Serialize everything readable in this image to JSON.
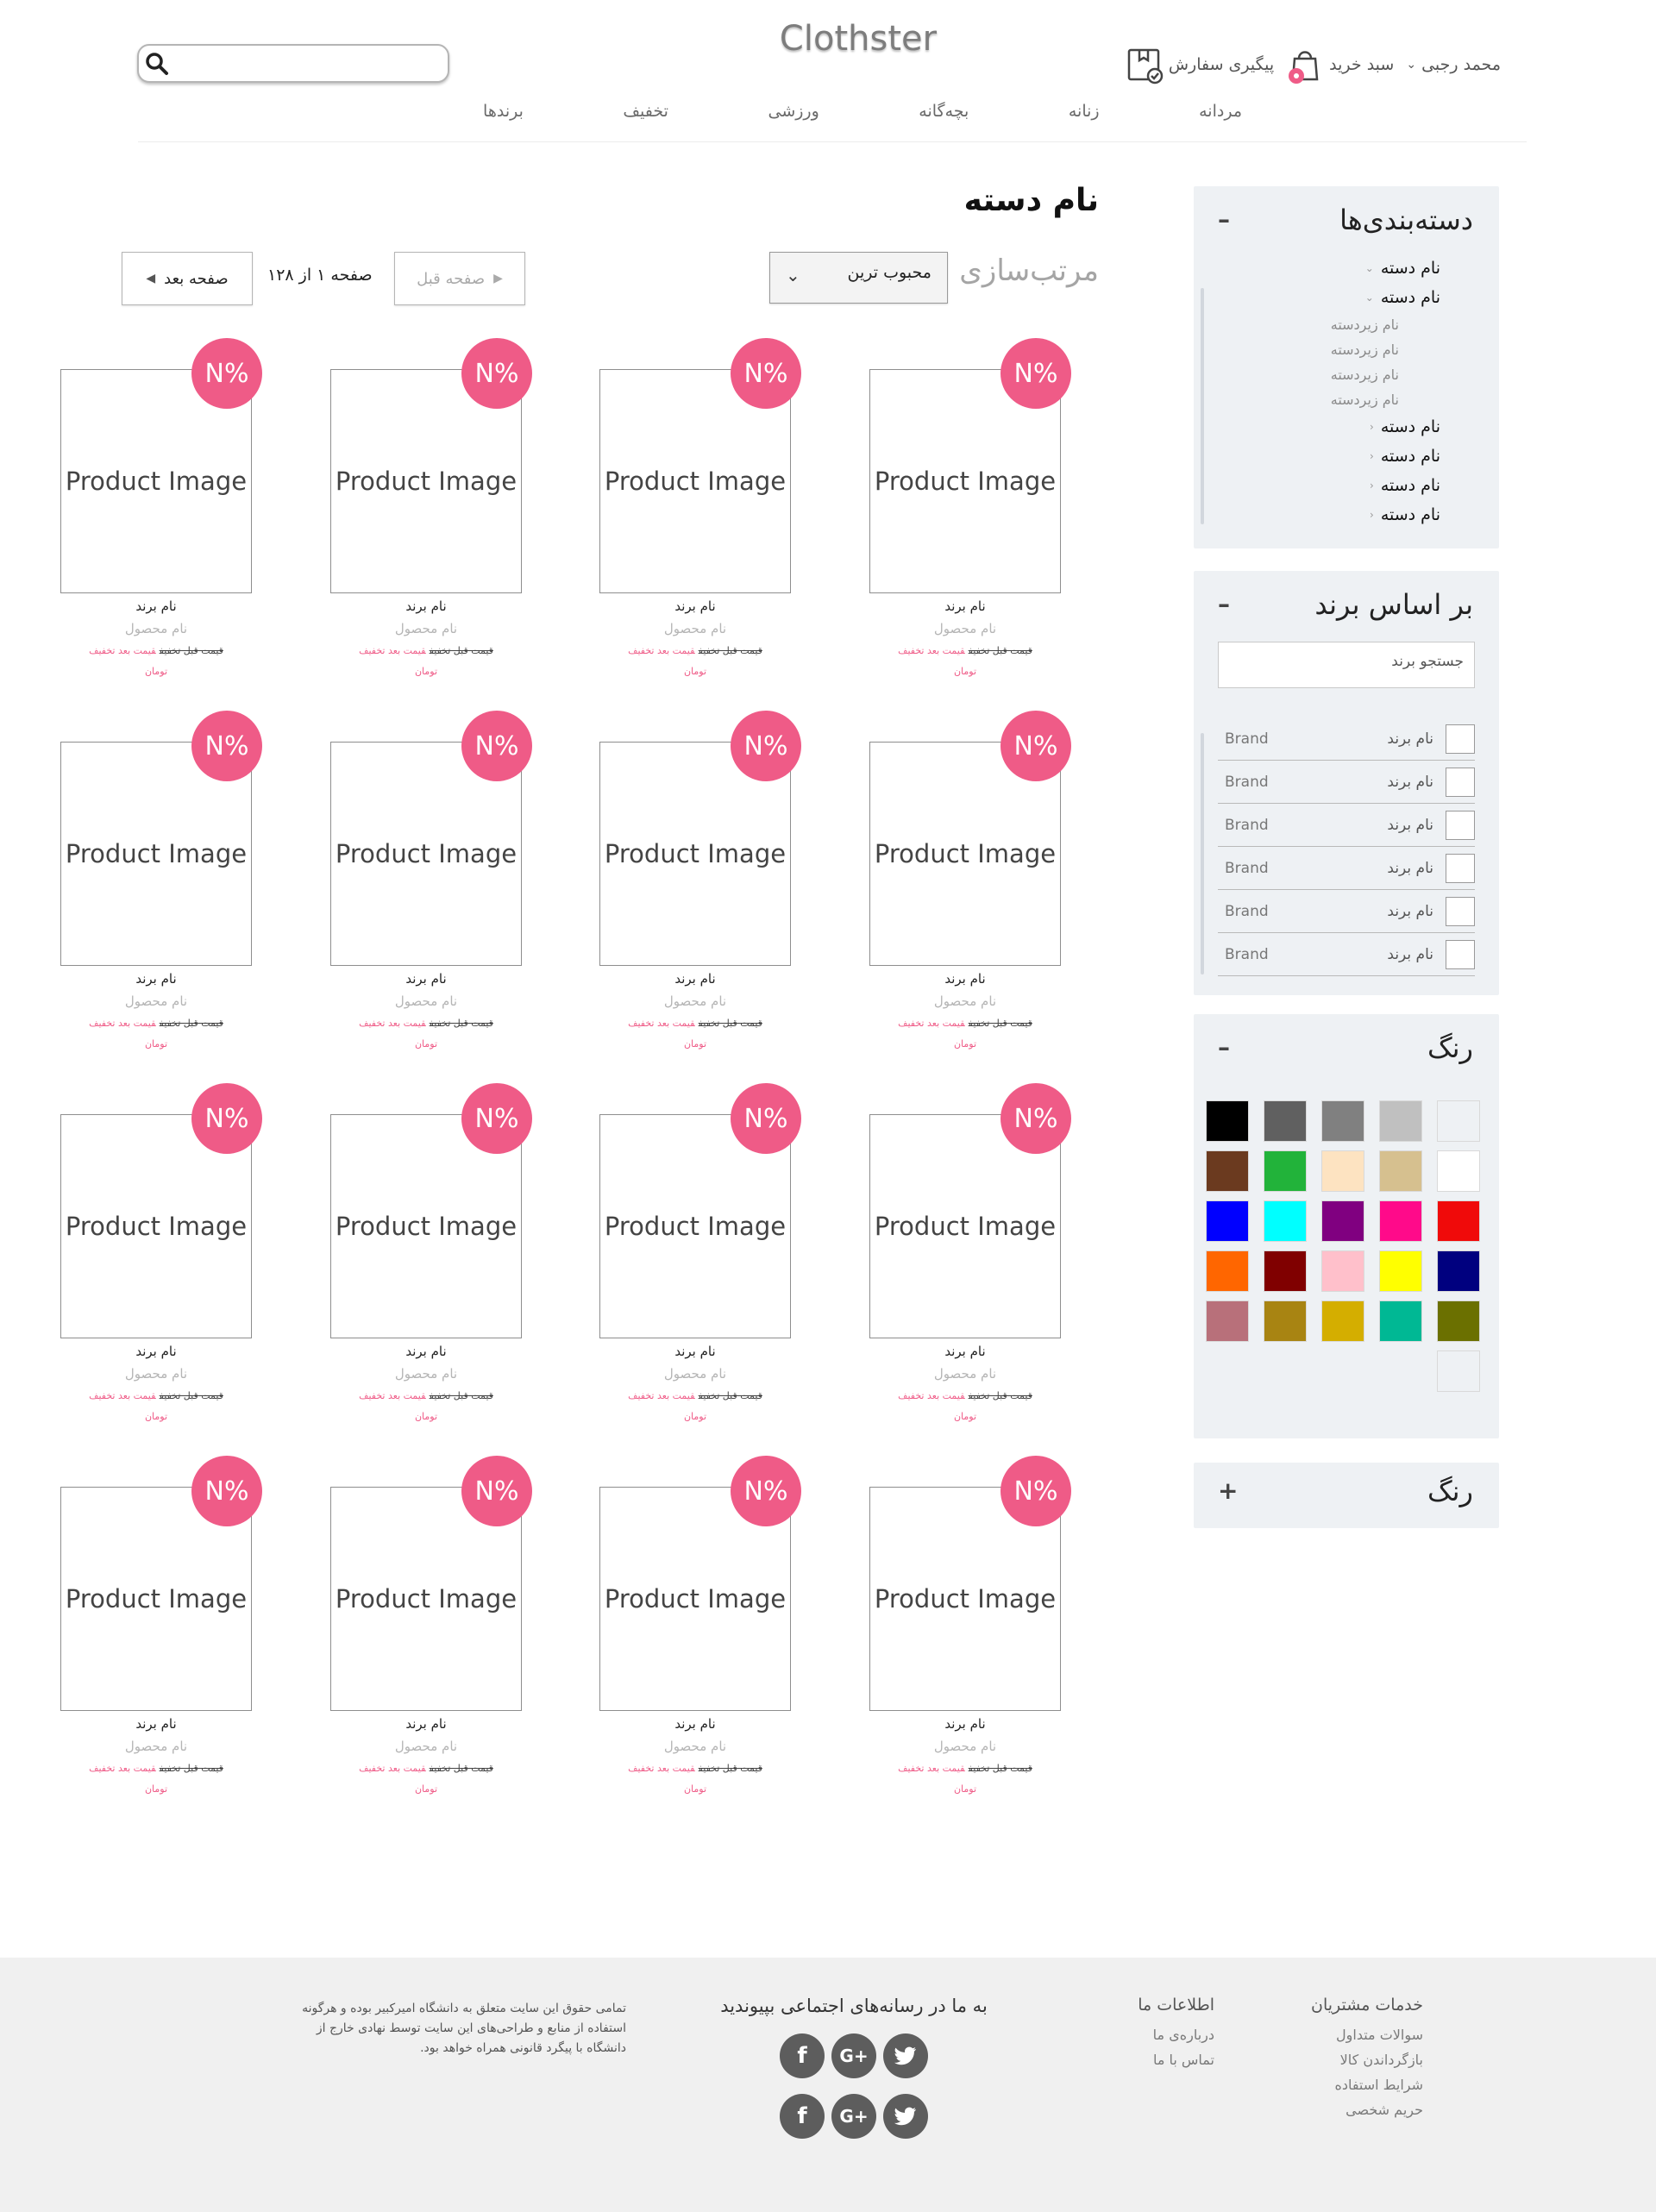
{
  "header": {
    "logo": "Clothster",
    "search_placeholder": "",
    "user_name": "محمد رجبی",
    "cart_label": "سبد خرید",
    "order_tracking_label": "پیگیری سفارش",
    "accent_color": "#ef5b87"
  },
  "nav": {
    "items": [
      "مردانه",
      "زنانه",
      "بچه‌گانه",
      "ورزشی",
      "تخفیف",
      "برندها"
    ]
  },
  "main": {
    "category_title": "نام دسته",
    "sort_label": "مرتب‌سازی",
    "sort_selected": "محبوب ترین",
    "pagination": {
      "prev_label": "صفحه قبل",
      "next_label": "صفحه بعد",
      "info": "صفحه ۱ از ۱۲۸"
    },
    "product": {
      "image_text": "Product Image",
      "badge": "N%",
      "brand": "نام برند",
      "name": "نام محصول",
      "old_price": "قیمت قبل تخفیف",
      "new_price": "قیمت بعد تخفیف",
      "currency": "تومان"
    }
  },
  "sidebar": {
    "categories": {
      "title": "دسته‌بندی‌ها",
      "toggle": "–",
      "items": [
        {
          "label": "نام دسته",
          "type": "cat"
        },
        {
          "label": "نام دسته",
          "type": "cat"
        },
        {
          "label": "نام زیردسته",
          "type": "sub"
        },
        {
          "label": "نام زیردسته",
          "type": "sub"
        },
        {
          "label": "نام زیردسته",
          "type": "sub"
        },
        {
          "label": "نام زیردسته",
          "type": "sub"
        },
        {
          "label": "نام دسته",
          "type": "cat"
        },
        {
          "label": "نام دسته",
          "type": "cat"
        },
        {
          "label": "نام دسته",
          "type": "cat"
        },
        {
          "label": "نام دسته",
          "type": "cat"
        }
      ]
    },
    "brands": {
      "title": "بر اساس برند",
      "toggle": "–",
      "search_placeholder": "جستجو برند",
      "items": [
        {
          "name": "نام برند",
          "en": "Brand"
        },
        {
          "name": "نام برند",
          "en": "Brand"
        },
        {
          "name": "نام برند",
          "en": "Brand"
        },
        {
          "name": "نام برند",
          "en": "Brand"
        },
        {
          "name": "نام برند",
          "en": "Brand"
        },
        {
          "name": "نام برند",
          "en": "Brand"
        }
      ]
    },
    "colors": {
      "title": "رنگ",
      "toggle": "–",
      "swatches": [
        "#000000",
        "#606060",
        "#808080",
        "#c0c0c0",
        "#eef1f4",
        "#6b3a1f",
        "#22b33a",
        "#fde3c1",
        "#d6c08f",
        "#ffffff",
        "#0000ff",
        "#00ffff",
        "#800080",
        "#ff0a8a",
        "#f00a0a",
        "#ff6600",
        "#800000",
        "#ffc0cb",
        "#ffff00",
        "#00007f",
        "#b8707a",
        "#a88412",
        "#d4ae00",
        "#00b894",
        "#6b7000",
        "#eef1f4"
      ]
    },
    "colors2": {
      "title": "رنگ",
      "toggle": "+"
    }
  },
  "footer": {
    "customer_service": {
      "title": "خدمات مشتریان",
      "links": [
        "سوالات متداول",
        "بازگرداندن کالا",
        "شرایط استفاده",
        "حریم شخصی"
      ]
    },
    "about": {
      "title": "اطلاعات ما",
      "links": [
        "درباره‌ی ما",
        "تماس با ما"
      ]
    },
    "social_title": "به ما در رسانه‌های اجتماعی بپیوندید",
    "social_icons": [
      "facebook-icon",
      "google-plus-icon",
      "twitter-icon"
    ],
    "legal_lines": [
      "تمامی حقوق این سایت متعلق به دانشگاه امیرکبیر بوده و هرگونه",
      "استفاده از منابع و طراحی‌های این سایت توسط نهادی خارج از",
      "دانشگاه با پیگرد قانونی همراه خواهد بود."
    ]
  }
}
